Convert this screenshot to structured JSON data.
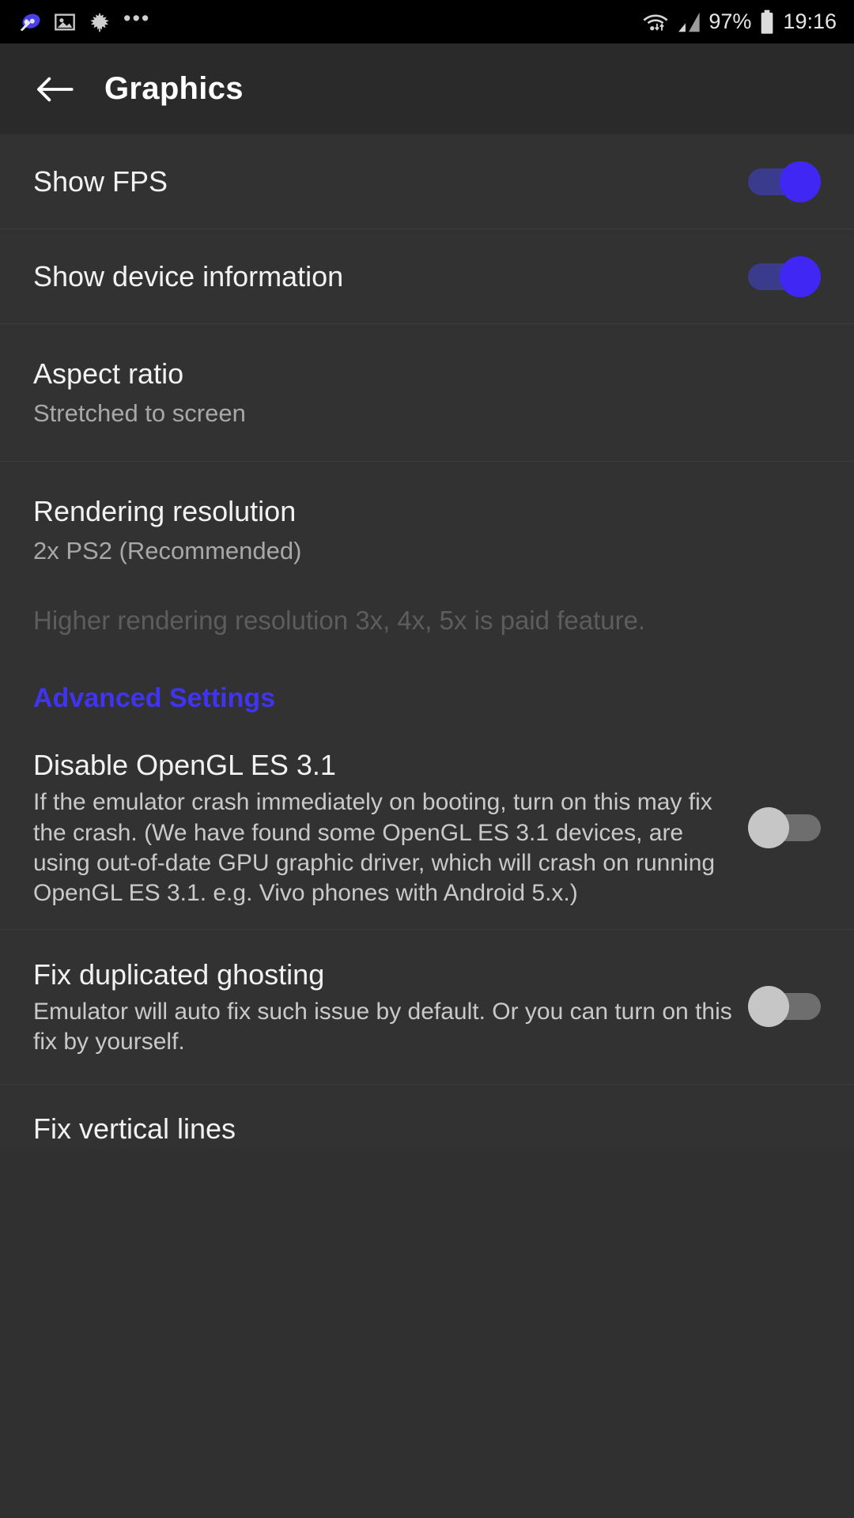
{
  "statusbar": {
    "icons_left": [
      "settings-wrench-icon",
      "image-icon",
      "maple-leaf-icon"
    ],
    "overflow": "•••",
    "wifi_icon": "wifi-icon",
    "signal_icon": "cellular-signal-icon",
    "battery_percent": "97%",
    "battery_icon": "battery-icon",
    "time": "19:16"
  },
  "appbar": {
    "back_icon": "back-arrow-icon",
    "title": "Graphics"
  },
  "settings": {
    "show_fps": {
      "title": "Show FPS",
      "state": "on"
    },
    "show_device_information": {
      "title": "Show device information",
      "state": "on"
    },
    "aspect_ratio": {
      "title": "Aspect ratio",
      "value": "Stretched to screen"
    },
    "rendering_resolution": {
      "title": "Rendering resolution",
      "value": "2x PS2 (Recommended)"
    },
    "paid_hint": "Higher rendering resolution 3x, 4x, 5x is paid feature.",
    "advanced_settings_label": "Advanced Settings",
    "disable_opengl": {
      "title": "Disable OpenGL ES 3.1",
      "description": "If the emulator crash immediately on booting, turn on this may fix the crash. (We have found some OpenGL ES 3.1 devices, are using out-of-date GPU graphic driver, which will crash on running OpenGL ES 3.1. e.g. Vivo phones with Android 5.x.)",
      "state": "off"
    },
    "fix_ghosting": {
      "title": "Fix duplicated ghosting",
      "description": "Emulator will auto fix such issue by default. Or you can turn on this fix by yourself.",
      "state": "off"
    },
    "partial_bottom": {
      "title": "Fix vertical lines"
    }
  },
  "colors": {
    "accent": "#4034f0",
    "toggle_on_knob": "#4127f4",
    "toggle_on_track": "#3b3b8e",
    "toggle_off_knob": "#c6c6c6",
    "toggle_off_track": "#6e6e6e",
    "background": "#323232",
    "appbar": "#2a2a2a"
  }
}
